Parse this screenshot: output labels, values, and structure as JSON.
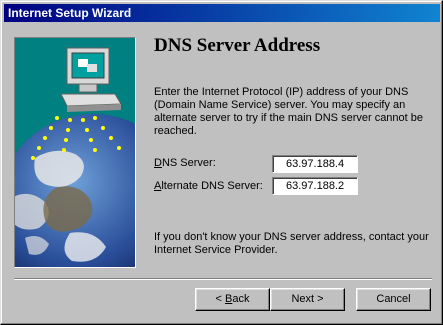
{
  "window": {
    "title": "Internet Setup Wizard"
  },
  "page": {
    "heading": "DNS Server Address",
    "description": "Enter the Internet Protocol (IP) address of your DNS (Domain Name Service) server.  You may specify an alternate server to try if the main DNS server cannot be reached.",
    "dns_label_prefix": "",
    "dns_label_key": "D",
    "dns_label_rest": "NS Server:",
    "dns_value": "63.97.188.4",
    "alt_label_prefix": "",
    "alt_label_key": "A",
    "alt_label_rest": "lternate DNS Server:",
    "alt_value": "63.97.188.2",
    "note": "If you don't know your DNS server address, contact your Internet Service Provider."
  },
  "buttons": {
    "back_prefix": "< ",
    "back_key": "B",
    "back_rest": "ack",
    "next": "Next >",
    "cancel": "Cancel"
  },
  "icons": {
    "illustration": "computer-earth-illustration"
  }
}
